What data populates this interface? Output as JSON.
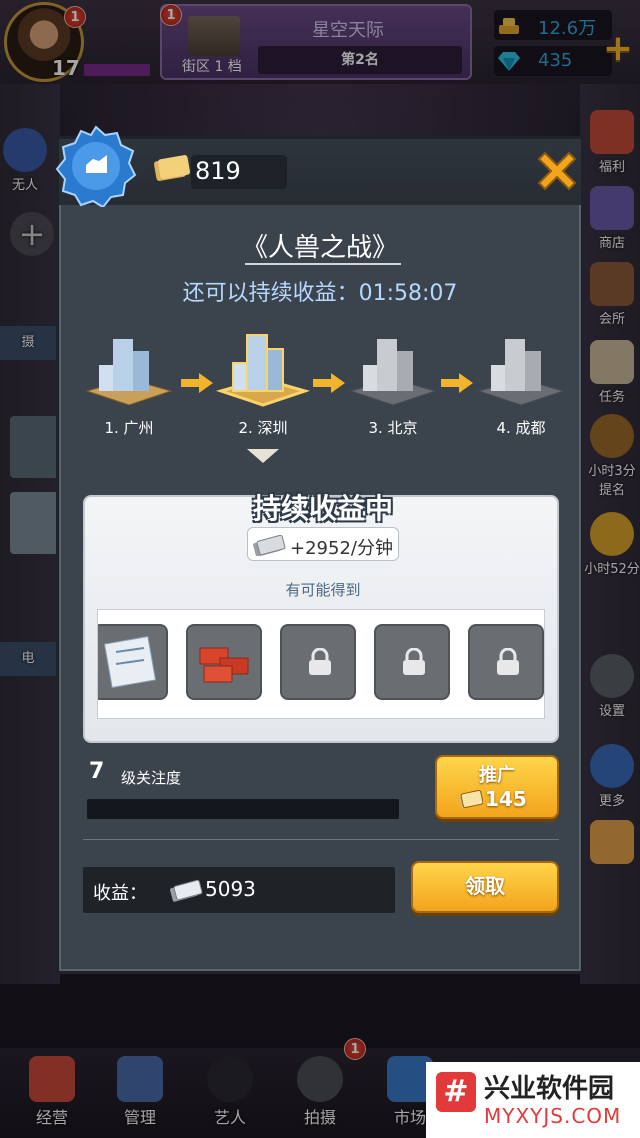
{
  "topbar": {
    "level": "17",
    "avatar_notif": "1",
    "district_notif": "1",
    "district_label": "街区 1 档",
    "district_name": "星空天际",
    "rank": "第2名",
    "gold": "12.6万",
    "diamonds": "435"
  },
  "side_left": {
    "no_one": "无人",
    "tab2": "摄",
    "tab3": "电"
  },
  "side_right": {
    "welfare": "福利",
    "shop": "商店",
    "club": "会所",
    "tasks": "任务",
    "timer1": "小时3分",
    "nominate": "提名",
    "timer2": "小时52分",
    "settings": "设置",
    "more": "更多"
  },
  "modal": {
    "ticket_count": "819",
    "movie_title": "《人兽之战》",
    "countdown": "还可以持续收益：01:58:07",
    "cities": [
      {
        "label": "1. 广州",
        "state": "done"
      },
      {
        "label": "2. 深圳",
        "state": "active"
      },
      {
        "label": "3. 北京",
        "state": "locked"
      },
      {
        "label": "4. 成都",
        "state": "locked"
      }
    ],
    "income_title": "持续收益中",
    "rate": "+2952/分钟",
    "possible_label": "有可能得到",
    "rewards": [
      {
        "name": "blueprint",
        "locked": false
      },
      {
        "name": "bricks",
        "locked": false
      },
      {
        "name": "item-3",
        "locked": true
      },
      {
        "name": "item-4",
        "locked": true
      },
      {
        "name": "item-5",
        "locked": true
      }
    ],
    "attention_level": "7",
    "attention_label": "级关注度",
    "promote_label": "推广",
    "promote_cost": "145",
    "earnings_label": "收益：",
    "earnings_value": "5093",
    "collect_label": "领取"
  },
  "bottom_nav": [
    {
      "label": "经营"
    },
    {
      "label": "管理"
    },
    {
      "label": "艺人"
    },
    {
      "label": "拍摄",
      "notif": "1"
    },
    {
      "label": "市场"
    }
  ],
  "watermark": {
    "logo": "#",
    "title": "兴业软件园",
    "url": "MYXYJS.COM"
  },
  "colors": {
    "accent_gold": "#f2a41c",
    "countdown_blue": "#b6d8ff",
    "diamond_blue": "#2fa6d8"
  }
}
